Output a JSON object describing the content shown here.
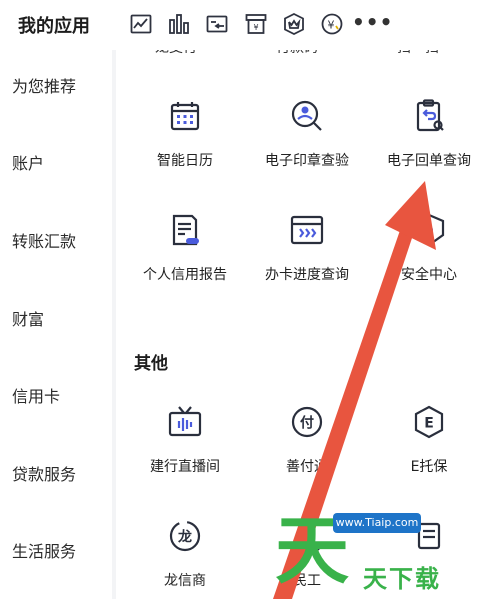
{
  "header": {
    "title": "我的应用",
    "icons": [
      "chart-icon",
      "bar-chart-icon",
      "transfer-card-icon",
      "bill-icon",
      "crown-shield-icon",
      "yuan-coin-icon"
    ],
    "more_label": "•••"
  },
  "sidebar": {
    "items": [
      {
        "label": "为您推荐"
      },
      {
        "label": "账户"
      },
      {
        "label": "转账汇款"
      },
      {
        "label": "财富"
      },
      {
        "label": "信用卡"
      },
      {
        "label": "贷款服务"
      },
      {
        "label": "生活服务"
      }
    ]
  },
  "content": {
    "partial_row": [
      "龙支付",
      "付款码",
      "扫一扫"
    ],
    "grid": [
      {
        "label": "智能日历",
        "icon": "calendar-icon"
      },
      {
        "label": "电子印章查验",
        "icon": "seal-search-icon"
      },
      {
        "label": "电子回单查询",
        "icon": "receipt-search-icon"
      },
      {
        "label": "个人信用报告",
        "icon": "credit-report-icon"
      },
      {
        "label": "办卡进度查询",
        "icon": "card-progress-icon"
      },
      {
        "label": "安全中心",
        "icon": "shield-icon"
      }
    ],
    "other_title": "其他",
    "other_grid": [
      {
        "label": "建行直播间",
        "icon": "tv-live-icon"
      },
      {
        "label": "善付通",
        "icon": "pay-badge-icon"
      },
      {
        "label": "E托保",
        "icon": "e-badge-icon"
      },
      {
        "label": "龙信商",
        "icon": "dragon-icon"
      },
      {
        "label": "民工",
        "icon": "worker-icon"
      },
      {
        "label": "",
        "icon": "partial-icon"
      }
    ]
  },
  "overlay": {
    "arrow_color": "#e8553f"
  },
  "watermark": {
    "url": "www.Tiaip.com",
    "big": "天",
    "small": "天下载"
  }
}
